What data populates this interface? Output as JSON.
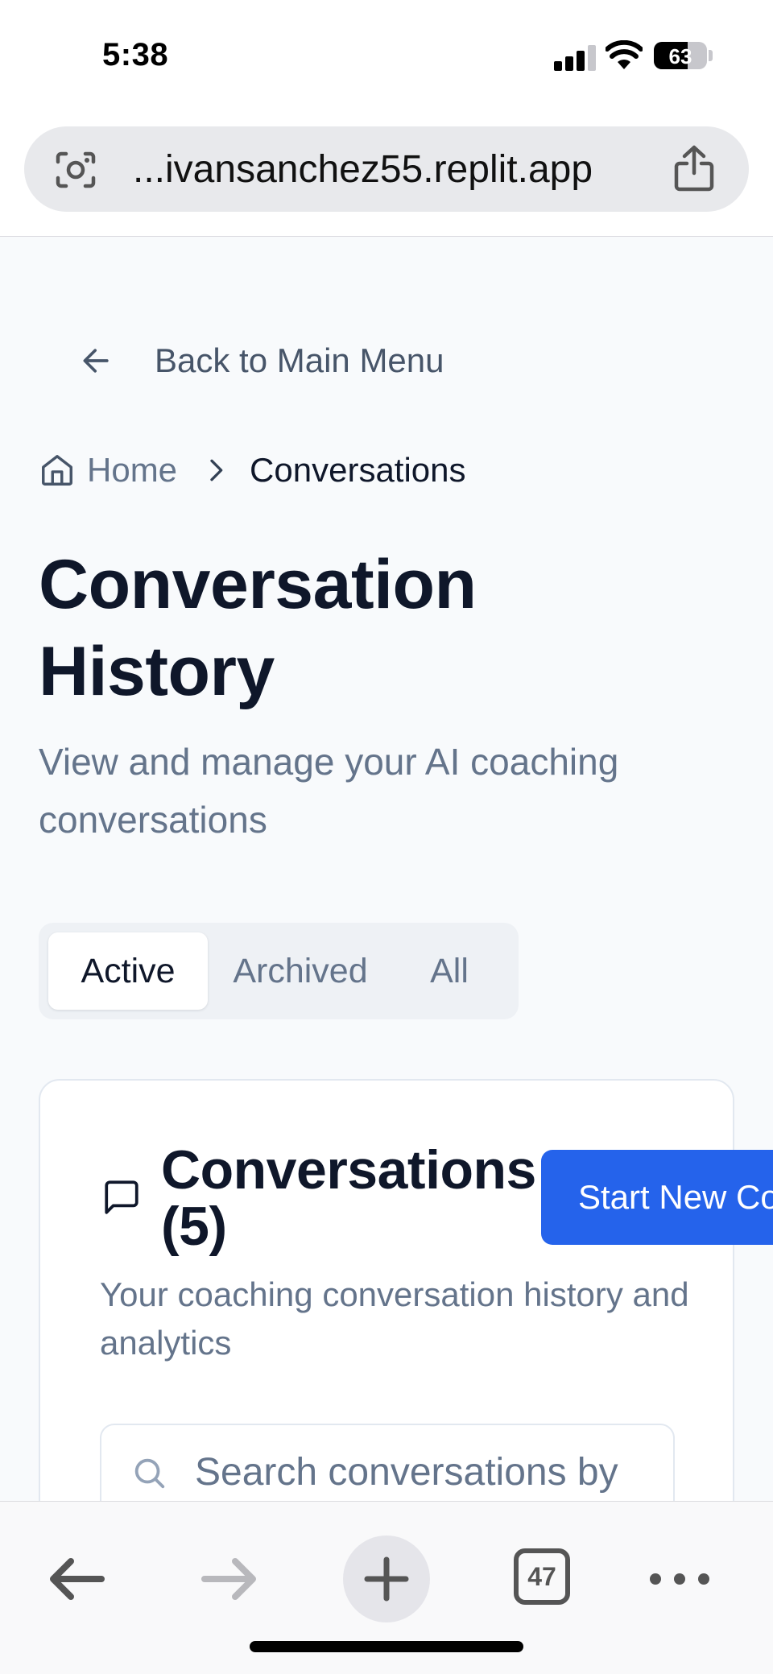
{
  "status_bar": {
    "time": "5:38",
    "battery": "63",
    "battery_level": 0.63
  },
  "browser": {
    "url": "...ivansanchez55.replit.app",
    "tab_count": "47"
  },
  "nav": {
    "back_label": "Back to Main Menu"
  },
  "breadcrumb": {
    "home": "Home",
    "current": "Conversations"
  },
  "page": {
    "title": "Conversation History",
    "subtitle": "View and manage your AI coaching conversations"
  },
  "tabs": [
    {
      "label": "Active",
      "active": true
    },
    {
      "label": "Archived",
      "active": false
    },
    {
      "label": "All",
      "active": false
    }
  ],
  "card": {
    "title": "Conversations (5)",
    "subtitle": "Your coaching conversation history and analytics",
    "button_label": "Start New Conversation",
    "search_placeholder": "Search conversations by"
  },
  "colors": {
    "primary": "#2563eb",
    "background": "#f8fafc",
    "text": "#0f172a",
    "muted": "#64748b"
  }
}
